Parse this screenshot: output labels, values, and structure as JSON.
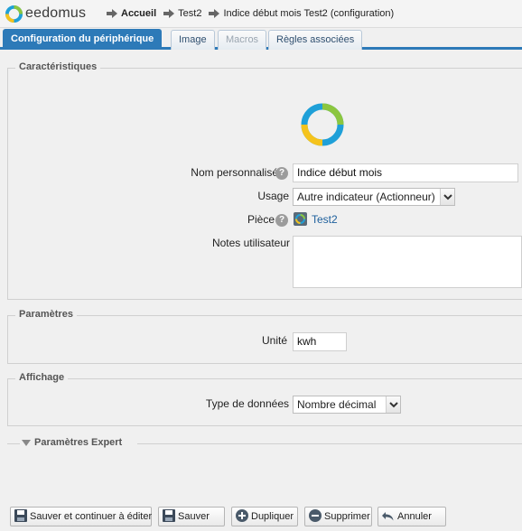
{
  "header": {
    "logo_text": "eedomus",
    "breadcrumb": [
      "Accueil",
      "Test2",
      "Indice début mois Test2 (configuration)"
    ]
  },
  "tabs": [
    {
      "label": "Configuration du périphérique",
      "state": "active"
    },
    {
      "label": "Image",
      "state": "normal"
    },
    {
      "label": "Macros",
      "state": "disabled"
    },
    {
      "label": "Règles associées",
      "state": "normal"
    }
  ],
  "caracteristiques": {
    "legend": "Caractéristiques",
    "nom_label": "Nom personnalisé",
    "nom_value": "Indice début mois",
    "usage_label": "Usage",
    "usage_value": "Autre indicateur (Actionneur)",
    "piece_label": "Pièce",
    "piece_value": "Test2",
    "notes_label": "Notes utilisateur",
    "notes_value": ""
  },
  "parametres": {
    "legend": "Paramètres",
    "unite_label": "Unité",
    "unite_value": "kwh"
  },
  "affichage": {
    "legend": "Affichage",
    "type_label": "Type de données",
    "type_value": "Nombre décimal"
  },
  "expert": {
    "legend": "Paramètres Expert"
  },
  "actions": {
    "save_continue": "Sauver et continuer à éditer",
    "save": "Sauver",
    "duplicate": "Dupliquer",
    "delete": "Supprimer",
    "cancel": "Annuler"
  },
  "colors": {
    "accent": "#2d7ab8",
    "ring_blue": "#1fa0d8",
    "ring_green": "#8cc63f",
    "ring_yellow": "#f5c31c"
  }
}
